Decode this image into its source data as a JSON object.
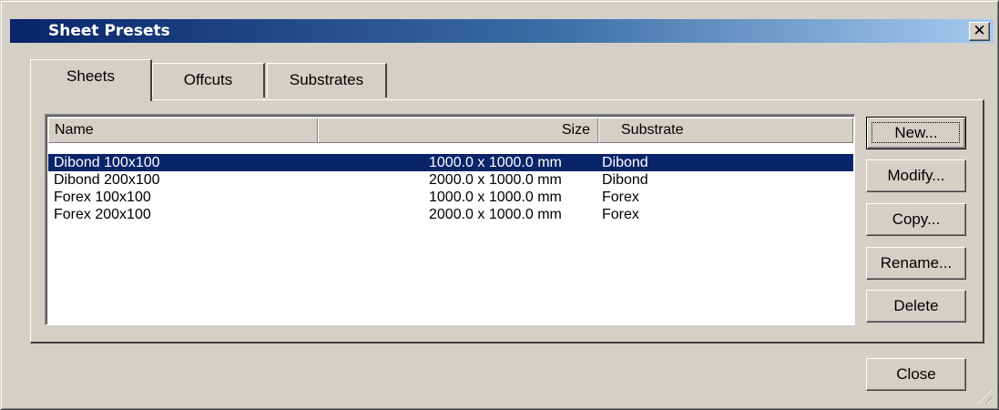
{
  "window": {
    "title": "Sheet Presets",
    "close_glyph": "✕"
  },
  "tabs": [
    {
      "label": "Sheets",
      "active": true
    },
    {
      "label": "Offcuts",
      "active": false
    },
    {
      "label": "Substrates",
      "active": false
    }
  ],
  "list": {
    "columns": [
      "Name",
      "Size",
      "Substrate"
    ],
    "rows": [
      {
        "name": "Dibond 100x100",
        "size": "1000.0 x 1000.0 mm",
        "substrate": "Dibond",
        "selected": true
      },
      {
        "name": "Dibond 200x100",
        "size": "2000.0 x 1000.0 mm",
        "substrate": "Dibond",
        "selected": false
      },
      {
        "name": "Forex 100x100",
        "size": "1000.0 x 1000.0 mm",
        "substrate": "Forex",
        "selected": false
      },
      {
        "name": "Forex 200x100",
        "size": "2000.0 x 1000.0 mm",
        "substrate": "Forex",
        "selected": false
      }
    ]
  },
  "buttons": {
    "new": "New...",
    "modify": "Modify...",
    "copy": "Copy...",
    "rename": "Rename...",
    "delete": "Delete",
    "close": "Close"
  },
  "colors": {
    "selection": "#0a246a",
    "face": "#d4d0c8",
    "title_start": "#0a246a",
    "title_end": "#a6caf0"
  }
}
